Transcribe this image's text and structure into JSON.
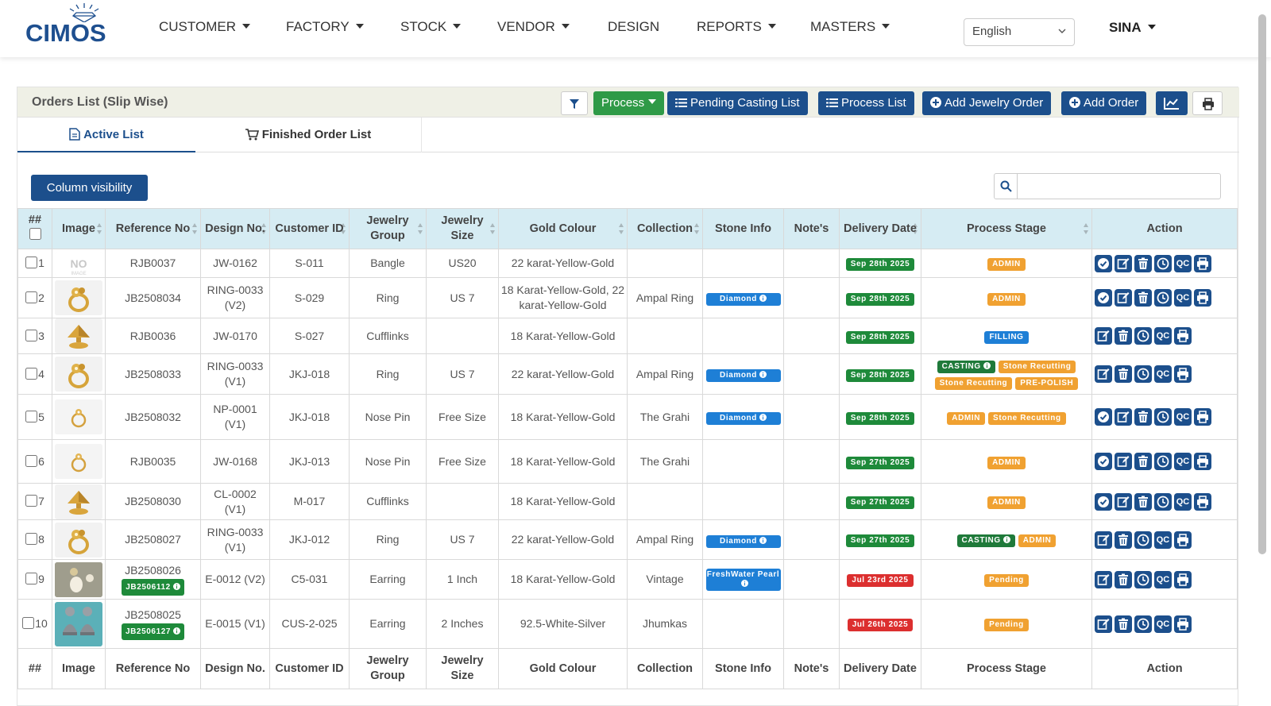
{
  "app": {
    "logo_text": "CIMOS",
    "language": "English",
    "user": "SINA",
    "menu": [
      "CUSTOMER",
      "FACTORY",
      "STOCK",
      "VENDOR",
      "DESIGN",
      "REPORTS",
      "MASTERS"
    ]
  },
  "card": {
    "title": "Orders List (Slip Wise)",
    "buttons": {
      "process": "Process",
      "pending_casting": "Pending Casting List",
      "process_list": "Process List",
      "add_jewelry_order": "Add Jewelry Order",
      "add_order": "Add Order"
    },
    "tabs": {
      "active": "Active List",
      "finished": "Finished Order List"
    },
    "column_visibility": "Column visibility",
    "search_value": ""
  },
  "table": {
    "headers": [
      "##",
      "Image",
      "Reference No",
      "Design No.",
      "Customer ID",
      "Jewelry Group",
      "Jewelry Size",
      "Gold Colour",
      "Collection",
      "Stone Info",
      "Note's",
      "Delivery Date",
      "Process Stage",
      "Action"
    ],
    "rows": [
      {
        "num": "1",
        "image": "no-image",
        "ref": "RJB0037",
        "ref_sub": "",
        "design": "JW-0162",
        "customer": "S-011",
        "group": "Bangle",
        "size": "US20",
        "gold": "22 karat-Yellow-Gold",
        "collection": "",
        "stone": "",
        "note": "",
        "date": "Sep 28th 2025",
        "date_status": "green",
        "stages": [
          {
            "label": "ADMIN",
            "color": "orange"
          }
        ],
        "actions": [
          "approve",
          "edit",
          "delete",
          "history",
          "QC",
          "print"
        ]
      },
      {
        "num": "2",
        "image": "ring",
        "ref": "JB2508034",
        "ref_sub": "",
        "design": "RING-0033 (V2)",
        "customer": "S-029",
        "group": "Ring",
        "size": "US 7",
        "gold": "18 Karat-Yellow-Gold, 22 karat-Yellow-Gold",
        "collection": "Ampal Ring",
        "stone": "Diamond",
        "note": "",
        "date": "Sep 28th 2025",
        "date_status": "green",
        "stages": [
          {
            "label": "ADMIN",
            "color": "orange"
          }
        ],
        "actions": [
          "approve",
          "edit",
          "delete",
          "history",
          "QC",
          "print"
        ]
      },
      {
        "num": "3",
        "image": "cufflink",
        "ref": "RJB0036",
        "ref_sub": "",
        "design": "JW-0170",
        "customer": "S-027",
        "group": "Cufflinks",
        "size": "",
        "gold": "18 Karat-Yellow-Gold",
        "collection": "",
        "stone": "",
        "note": "",
        "date": "Sep 28th 2025",
        "date_status": "green",
        "stages": [
          {
            "label": "FILLING",
            "color": "blue"
          }
        ],
        "actions": [
          "edit",
          "delete",
          "history",
          "QC",
          "print"
        ]
      },
      {
        "num": "4",
        "image": "ring",
        "ref": "JB2508033",
        "ref_sub": "",
        "design": "RING-0033 (V1)",
        "customer": "JKJ-018",
        "group": "Ring",
        "size": "US 7",
        "gold": "22 karat-Yellow-Gold",
        "collection": "Ampal Ring",
        "stone": "Diamond",
        "note": "",
        "date": "Sep 28th 2025",
        "date_status": "green",
        "stages": [
          {
            "label": "CASTING",
            "color": "casting"
          },
          {
            "label": "Stone Recutting",
            "color": "orange"
          },
          {
            "label": "Stone Recutting",
            "color": "orange"
          },
          {
            "label": "PRE-POLISH",
            "color": "orange"
          }
        ],
        "actions": [
          "edit",
          "delete",
          "history",
          "QC",
          "print"
        ]
      },
      {
        "num": "5",
        "image": "nosepin",
        "ref": "JB2508032",
        "ref_sub": "",
        "design": "NP-0001 (V1)",
        "customer": "JKJ-018",
        "group": "Nose Pin",
        "size": "Free Size",
        "gold": "18 Karat-Yellow-Gold",
        "collection": "The Grahi",
        "stone": "Diamond",
        "note": "",
        "date": "Sep 28th 2025",
        "date_status": "green",
        "stages": [
          {
            "label": "ADMIN",
            "color": "orange"
          },
          {
            "label": "Stone Recutting",
            "color": "orange"
          }
        ],
        "actions": [
          "approve",
          "edit",
          "delete",
          "history",
          "QC",
          "print"
        ]
      },
      {
        "num": "6",
        "image": "nosepin",
        "ref": "RJB0035",
        "ref_sub": "",
        "design": "JW-0168",
        "customer": "JKJ-013",
        "group": "Nose Pin",
        "size": "Free Size",
        "gold": "18 Karat-Yellow-Gold",
        "collection": "The Grahi",
        "stone": "",
        "note": "",
        "date": "Sep 27th 2025",
        "date_status": "green",
        "stages": [
          {
            "label": "ADMIN",
            "color": "orange"
          }
        ],
        "actions": [
          "approve",
          "edit",
          "delete",
          "history",
          "QC",
          "print"
        ]
      },
      {
        "num": "7",
        "image": "cufflink",
        "ref": "JB2508030",
        "ref_sub": "",
        "design": "CL-0002 (V1)",
        "customer": "M-017",
        "group": "Cufflinks",
        "size": "",
        "gold": "18 Karat-Yellow-Gold",
        "collection": "",
        "stone": "",
        "note": "",
        "date": "Sep 27th 2025",
        "date_status": "green",
        "stages": [
          {
            "label": "ADMIN",
            "color": "orange"
          }
        ],
        "actions": [
          "approve",
          "edit",
          "delete",
          "history",
          "QC",
          "print"
        ]
      },
      {
        "num": "8",
        "image": "ring",
        "ref": "JB2508027",
        "ref_sub": "",
        "design": "RING-0033 (V1)",
        "customer": "JKJ-012",
        "group": "Ring",
        "size": "US 7",
        "gold": "22 karat-Yellow-Gold",
        "collection": "Ampal Ring",
        "stone": "Diamond",
        "note": "",
        "date": "Sep 27th 2025",
        "date_status": "green",
        "stages": [
          {
            "label": "CASTING",
            "color": "casting"
          },
          {
            "label": "ADMIN",
            "color": "orange"
          }
        ],
        "actions": [
          "edit",
          "delete",
          "history",
          "QC",
          "print"
        ]
      },
      {
        "num": "9",
        "image": "earring-pearl",
        "ref": "JB2508026",
        "ref_sub": "JB2506112",
        "design": "E-0012 (V2)",
        "customer": "C5-031",
        "group": "Earring",
        "size": "1 Inch",
        "gold": "18 Karat-Yellow-Gold",
        "collection": "Vintage",
        "stone": "FreshWater Pearl",
        "note": "",
        "date": "Jul 23rd 2025",
        "date_status": "red",
        "stages": [
          {
            "label": "Pending",
            "color": "orange"
          }
        ],
        "actions": [
          "edit",
          "delete",
          "history",
          "QC",
          "print"
        ]
      },
      {
        "num": "10",
        "image": "jhumka",
        "ref": "JB2508025",
        "ref_sub": "JB2506127",
        "design": "E-0015 (V1)",
        "customer": "CUS-2-025",
        "group": "Earring",
        "size": "2 Inches",
        "gold": "92.5-White-Silver",
        "collection": "Jhumkas",
        "stone": "",
        "note": "",
        "date": "Jul 26th 2025",
        "date_status": "red",
        "stages": [
          {
            "label": "Pending",
            "color": "orange"
          }
        ],
        "actions": [
          "edit",
          "delete",
          "history",
          "QC",
          "print"
        ]
      }
    ]
  },
  "colors": {
    "navy": "#1c4f8c",
    "green": "#2f9a47",
    "header_bg": "#d6ecf3",
    "admin": "#f0a131"
  }
}
